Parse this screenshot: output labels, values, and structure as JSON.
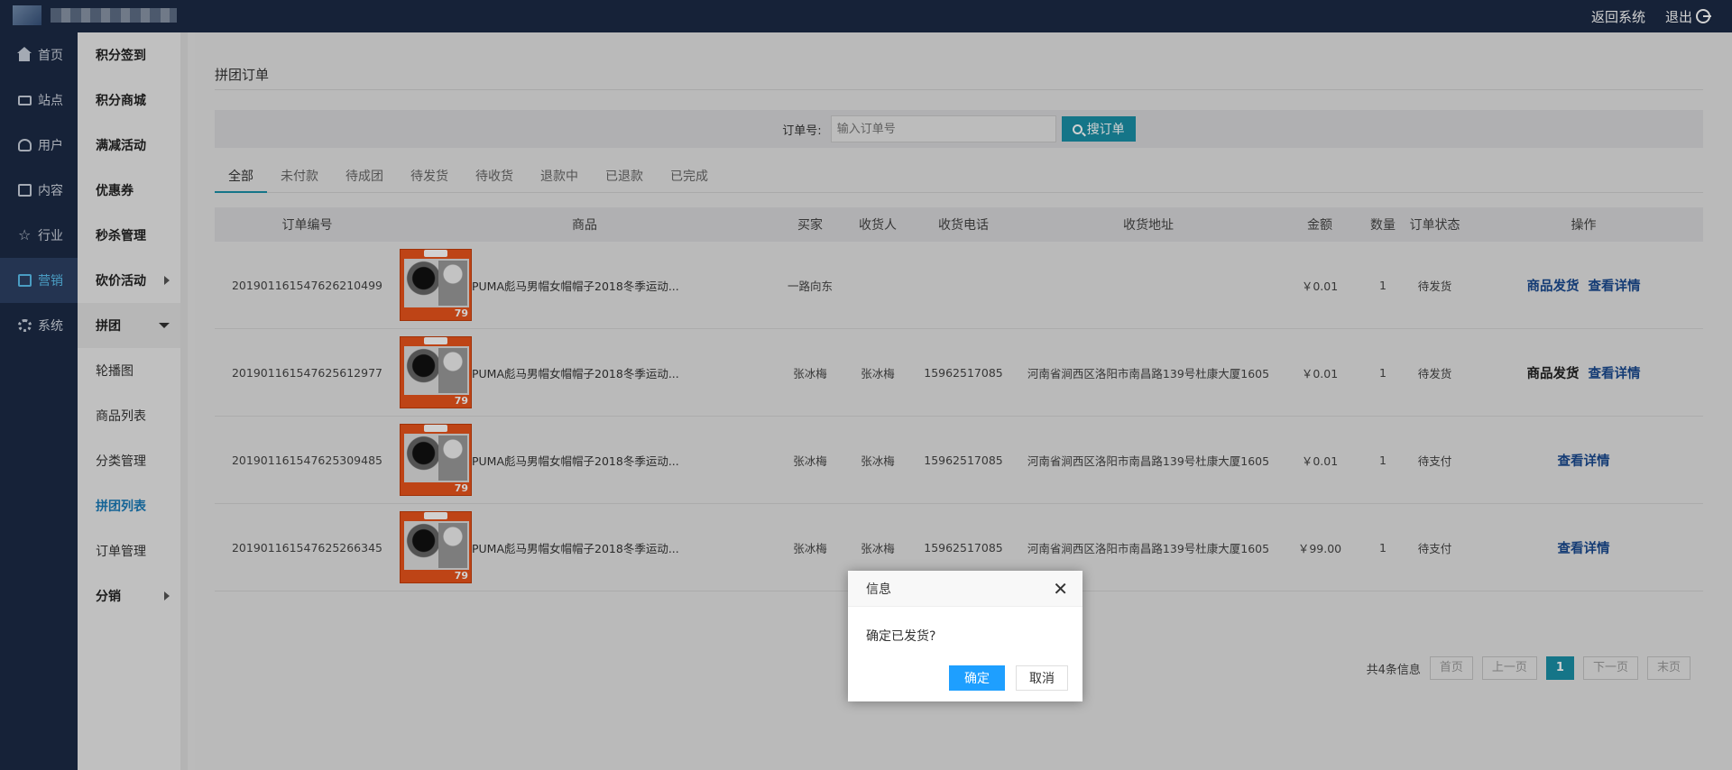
{
  "topbar": {
    "back_label": "返回系统",
    "logout_label": "退出"
  },
  "nav1": [
    {
      "label": "首页",
      "icon": "home-icon"
    },
    {
      "label": "站点",
      "icon": "monitor-icon"
    },
    {
      "label": "用户",
      "icon": "user-icon"
    },
    {
      "label": "内容",
      "icon": "mail-icon"
    },
    {
      "label": "行业",
      "icon": "star-icon"
    },
    {
      "label": "营销",
      "icon": "marketing-icon",
      "active": true
    },
    {
      "label": "系统",
      "icon": "gear-icon"
    }
  ],
  "nav2": {
    "items": [
      "积分签到",
      "积分商城",
      "满减活动",
      "优惠券",
      "秒杀管理",
      "砍价活动",
      "拼团",
      "轮播图",
      "商品列表",
      "分类管理",
      "拼团列表",
      "订单管理",
      "分销"
    ]
  },
  "page": {
    "title": "拼团订单"
  },
  "search": {
    "label": "订单号:",
    "placeholder": "输入订单号",
    "button": "搜订单"
  },
  "tabs": [
    "全部",
    "未付款",
    "待成团",
    "待发货",
    "待收货",
    "退款中",
    "已退款",
    "已完成"
  ],
  "table": {
    "headers": [
      "订单编号",
      "商品",
      "买家",
      "收货人",
      "收货电话",
      "收货地址",
      "金额",
      "数量",
      "订单状态",
      "操作"
    ],
    "rows": [
      {
        "no": "201901161547626210499",
        "goods": "PUMA彪马男帽女帽帽子2018冬季运动...",
        "buyer": "一路向东",
        "receiver": "",
        "phone": "",
        "address": "",
        "amount": "￥0.01",
        "qty": "1",
        "status": "待发货",
        "op1": "商品发货",
        "op2": "查看详情",
        "thumb_price": "79"
      },
      {
        "no": "201901161547625612977",
        "goods": "PUMA彪马男帽女帽帽子2018冬季运动...",
        "buyer": "张冰梅",
        "receiver": "张冰梅",
        "phone": "15962517085",
        "address": "河南省涧西区洛阳市南昌路139号杜康大厦1605",
        "amount": "￥0.01",
        "qty": "1",
        "status": "待发货",
        "op1": "商品发货",
        "op2": "查看详情",
        "thumb_price": "79"
      },
      {
        "no": "201901161547625309485",
        "goods": "PUMA彪马男帽女帽帽子2018冬季运动...",
        "buyer": "张冰梅",
        "receiver": "张冰梅",
        "phone": "15962517085",
        "address": "河南省涧西区洛阳市南昌路139号杜康大厦1605",
        "amount": "￥0.01",
        "qty": "1",
        "status": "待支付",
        "op1": "",
        "op2": "查看详情",
        "thumb_price": "79"
      },
      {
        "no": "201901161547625266345",
        "goods": "PUMA彪马男帽女帽帽子2018冬季运动...",
        "buyer": "张冰梅",
        "receiver": "张冰梅",
        "phone": "15962517085",
        "address": "河南省涧西区洛阳市南昌路139号杜康大厦1605",
        "amount": "￥99.00",
        "qty": "1",
        "status": "待支付",
        "op1": "",
        "op2": "查看详情",
        "thumb_price": "79"
      }
    ]
  },
  "pager": {
    "info": "共4条信息",
    "first": "首页",
    "prev": "上一页",
    "current": "1",
    "next": "下一页",
    "last": "末页"
  },
  "dialog": {
    "title": "信息",
    "message": "确定已发货?",
    "ok": "确定",
    "cancel": "取消"
  },
  "colors": {
    "topbar": "#1b2a45",
    "accent": "#1a8fa6",
    "dialog_ok": "#1e9fff",
    "link": "#1a4a8f"
  }
}
